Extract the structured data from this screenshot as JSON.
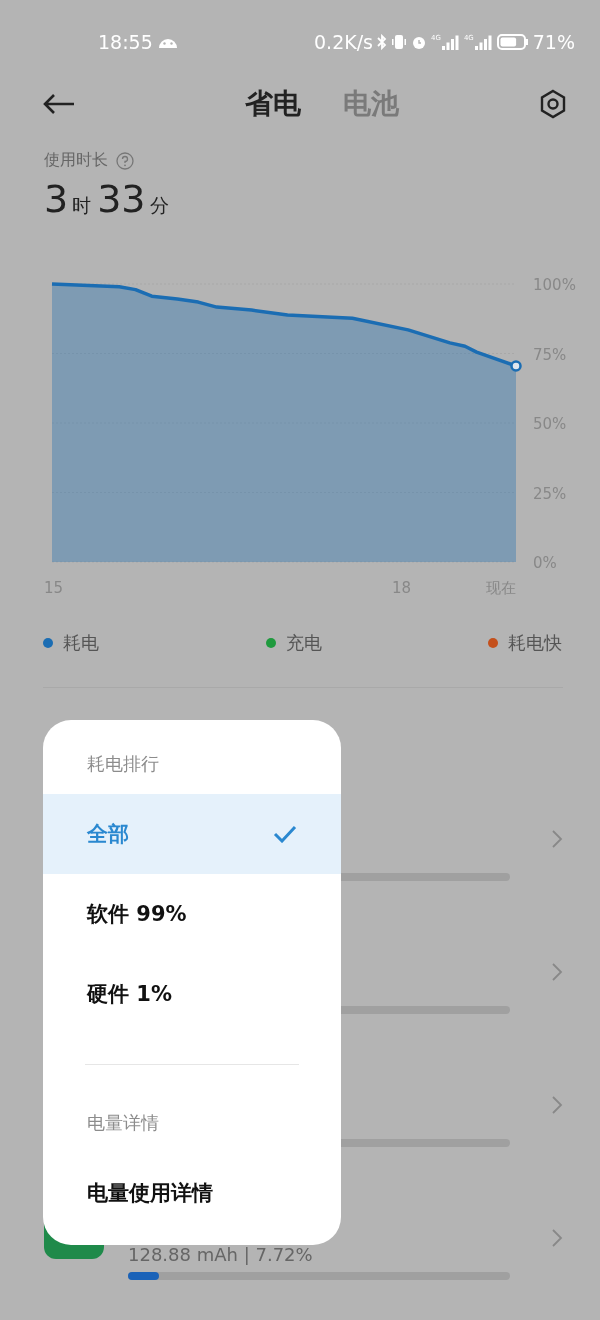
{
  "status_bar": {
    "time": "18:55",
    "speed": "0.2K/s",
    "signals": [
      {
        "label": "4G"
      },
      {
        "label": "4G"
      }
    ],
    "battery_text": "71%",
    "battery": {
      "level": 0.71
    }
  },
  "header": {
    "tabs": [
      {
        "label": "省电",
        "selected": true
      },
      {
        "label": "电池",
        "selected": false
      }
    ]
  },
  "usage": {
    "label": "使用时长",
    "value": [
      {
        "text": "3",
        "kind": "number"
      },
      {
        "text": "时",
        "kind": "unit"
      },
      {
        "text": "33",
        "kind": "number"
      },
      {
        "text": "分",
        "kind": "unit"
      }
    ]
  },
  "chart": {
    "chart_data": {
      "type": "area",
      "x": [
        15,
        15.58,
        15.72,
        15.86,
        16.08,
        16.26,
        16.42,
        16.72,
        17.03,
        17.59,
        18.07,
        18.43,
        18.56,
        18.66,
        19
      ],
      "series": [
        {
          "color": "#1b6db3",
          "values": [
            100,
            99,
            98,
            95.6,
            94.6,
            93.5,
            91.7,
            90.6,
            88.8,
            87.7,
            83.5,
            78.8,
            77.6,
            75.5,
            70.5
          ]
        }
      ],
      "xlim": [
        15,
        19
      ],
      "ylim": [
        0,
        100
      ],
      "xticks": [
        {
          "value": 15,
          "label": "15"
        },
        {
          "value": 18,
          "label": "18"
        },
        {
          "value": 19,
          "label": "现在"
        }
      ],
      "yticks": [
        {
          "value": 100,
          "label": "100%"
        },
        {
          "value": 75,
          "label": "75%"
        },
        {
          "value": 50,
          "label": "50%"
        },
        {
          "value": 25,
          "label": "25%"
        },
        {
          "value": 0,
          "label": "0%"
        }
      ]
    }
  },
  "legend": [
    {
      "label": "耗电",
      "color": "#1b6db3"
    },
    {
      "label": "充电",
      "color": "#1f9a3e"
    },
    {
      "label": "耗电快",
      "color": "#c4501c"
    }
  ],
  "rows": [
    {
      "kind": "covered"
    },
    {
      "kind": "covered"
    },
    {
      "kind": "covered"
    },
    {
      "kind": "app",
      "usage": "128.88 mAh | 7.72%",
      "level": 0.08
    }
  ],
  "menu": {
    "sections": [
      {
        "title": "耗电排行",
        "items": [
          {
            "label": "全部",
            "selected": true
          },
          {
            "label": "软件 99%",
            "selected": false
          },
          {
            "label": "硬件 1%",
            "selected": false
          }
        ]
      },
      {
        "title": "电量详情",
        "items": [
          {
            "label": "电量使用详情",
            "selected": false
          }
        ]
      }
    ]
  }
}
